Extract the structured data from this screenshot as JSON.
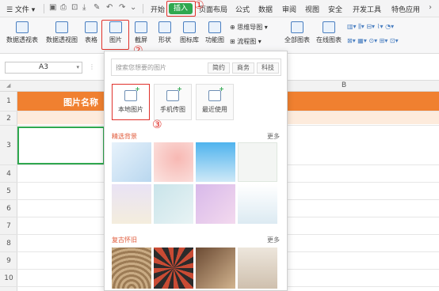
{
  "menubar": {
    "menu_file": "☰ 文件 ▾",
    "tabs": [
      "开始",
      "插入",
      "页面布局",
      "公式",
      "数据",
      "审阅",
      "视图",
      "安全",
      "开发工具",
      "特色应用"
    ],
    "active_tab": "插入"
  },
  "ribbon": {
    "buttons": [
      "数据透视表",
      "数据透视图",
      "表格",
      "图片",
      "截屏",
      "形状",
      "图标库",
      "功能图",
      "全部图表",
      "在线图表"
    ],
    "small": [
      "思维导图",
      "流程图"
    ]
  },
  "formula_bar": {
    "name_box": "A3"
  },
  "sheet": {
    "column_b": "B",
    "rows": [
      "1",
      "2",
      "3",
      "4",
      "5",
      "6",
      "7",
      "8",
      "9",
      "10"
    ],
    "title_cell": "图片名称"
  },
  "panel": {
    "search_placeholder": "搜索您想要的图片",
    "chips": [
      "简约",
      "商务",
      "科技"
    ],
    "options": [
      "本地图片",
      "手机传图",
      "最近使用"
    ],
    "section1": "精选背景",
    "section2": "复古怀旧",
    "more": "更多"
  },
  "annotations": {
    "step1": "①",
    "step2": "②",
    "step3": "③"
  },
  "colors": {
    "accent_green": "#2fa84f",
    "title_orange": "#f08030",
    "annotation_red": "#e0312b"
  }
}
